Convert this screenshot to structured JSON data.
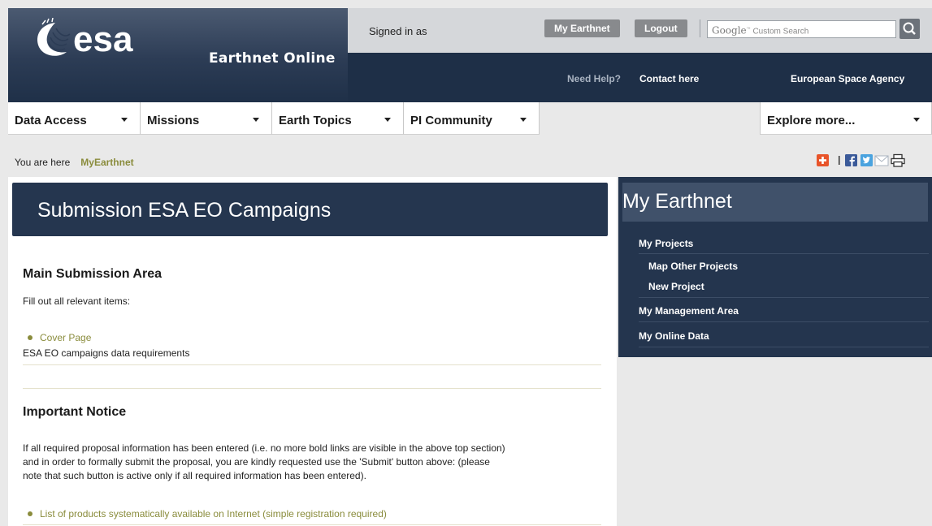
{
  "header": {
    "product_name": "Earthnet Online",
    "signed_in_label": "Signed in as",
    "my_earthnet_button": "My Earthnet",
    "logout_button": "Logout",
    "search": {
      "google_label": "Google",
      "placeholder": "Custom Search"
    },
    "need_help": "Need Help?",
    "contact_link": "Contact here",
    "agency_link": "European Space Agency"
  },
  "nav": {
    "items": [
      {
        "label": "Data Access"
      },
      {
        "label": "Missions"
      },
      {
        "label": "Earth Topics"
      },
      {
        "label": "PI Community"
      }
    ],
    "explore": "Explore more..."
  },
  "breadcrumb": {
    "prefix": "You are here",
    "current": "MyEarthnet"
  },
  "main": {
    "title": "Submission ESA EO Campaigns",
    "main_heading": "Main Submission Area",
    "instruction": "Fill out all relevant items:",
    "cover_link": "Cover Page",
    "cover_desc": "ESA EO campaigns data requirements",
    "notice_heading": "Important Notice",
    "notice_lines": [
      "If all required proposal information has been entered (i.e. no more bold links are visible in the above top section)",
      "and in order to formally submit the proposal, you are kindly requested use the 'Submit' button above: (please",
      "note that such button is active only if all required information has been entered)."
    ],
    "products_link": "List of products systematically available on Internet (simple registration required)"
  },
  "sidebar": {
    "title": "My Earthnet",
    "items": [
      {
        "label": "My Projects"
      },
      {
        "label": "Map Other Projects"
      },
      {
        "label": "New Project"
      },
      {
        "label": "My Management Area"
      },
      {
        "label": "My Online Data"
      }
    ]
  },
  "colors": {
    "header_dark": "#1e2f47",
    "title_box": "#25364f",
    "link_olive": "#8a8c3c",
    "button_grey": "#888a8d"
  }
}
